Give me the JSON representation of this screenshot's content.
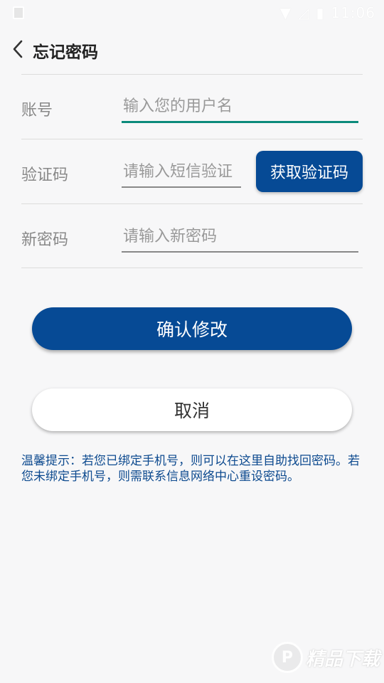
{
  "status_bar": {
    "time": "11:06",
    "icons": [
      "notification-icon",
      "wifi-icon",
      "signal-icon",
      "battery-icon"
    ]
  },
  "header": {
    "back_icon": "chevron-left-icon",
    "title": "忘记密码"
  },
  "form": {
    "account": {
      "label": "账号",
      "placeholder": "输入您的用户名",
      "value": ""
    },
    "code": {
      "label": "验证码",
      "placeholder": "请输入短信验证",
      "value": "",
      "button_label": "获取验证码"
    },
    "new_password": {
      "label": "新密码",
      "placeholder": "请输入新密码",
      "value": ""
    }
  },
  "actions": {
    "confirm_label": "确认修改",
    "cancel_label": "取消"
  },
  "tip": "温馨提示：若您已绑定手机号，则可以在这里自助找回密码。若您未绑定手机号，则需联系信息网络中心重设密码。",
  "watermark": {
    "text": "精品下载"
  },
  "colors": {
    "primary": "#064a95",
    "accent_focus": "#0b8a7b",
    "tip_text": "#0d4a8f",
    "background": "#f7f7f8"
  }
}
